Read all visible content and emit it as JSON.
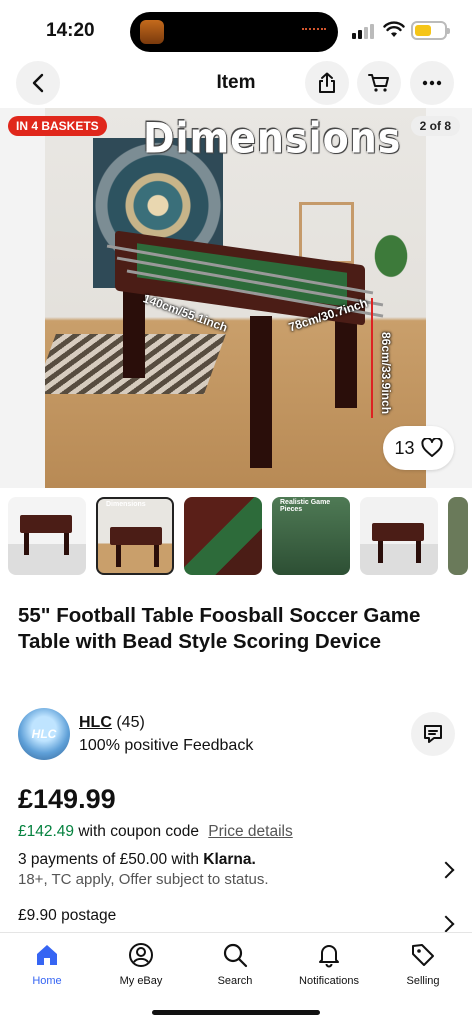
{
  "status_bar": {
    "time": "14:20"
  },
  "header": {
    "title": "Item"
  },
  "gallery": {
    "basket_badge": "IN 4 BASKETS",
    "page_indicator": "2 of 8",
    "image_overlay_title": "Dimensions",
    "dimension_length": "140cm/55.1inch",
    "dimension_width": "78cm/30.7inch",
    "dimension_height": "86cm/33.9inch",
    "watch_count": "13",
    "thumbnails": [
      {
        "caption": ""
      },
      {
        "caption": "Dimensions"
      },
      {
        "caption": ""
      },
      {
        "caption": "Realistic Game Pieces"
      },
      {
        "caption": ""
      }
    ]
  },
  "item": {
    "title": "55\" Football Table Foosball Soccer Game Table with Bead Style Scoring Device"
  },
  "seller": {
    "name": "HLC",
    "count": "(45)",
    "feedback": "100% positive Feedback",
    "avatar_text": "HLC"
  },
  "pricing": {
    "price": "£149.99",
    "coupon_price": "£142.49",
    "coupon_text": "with coupon code",
    "price_details": "Price details",
    "payments_text": "3 payments of £50.00 with",
    "klarna": "Klarna.",
    "payments_sub": "18+, TC apply, Offer subject to status.",
    "postage": "£9.90 postage"
  },
  "bottom_nav": {
    "home": "Home",
    "my_ebay": "My eBay",
    "search": "Search",
    "notifications": "Notifications",
    "selling": "Selling"
  },
  "colors": {
    "accent": "#3665f3",
    "badge_red": "#e0271b",
    "coupon_green": "#05823f"
  }
}
